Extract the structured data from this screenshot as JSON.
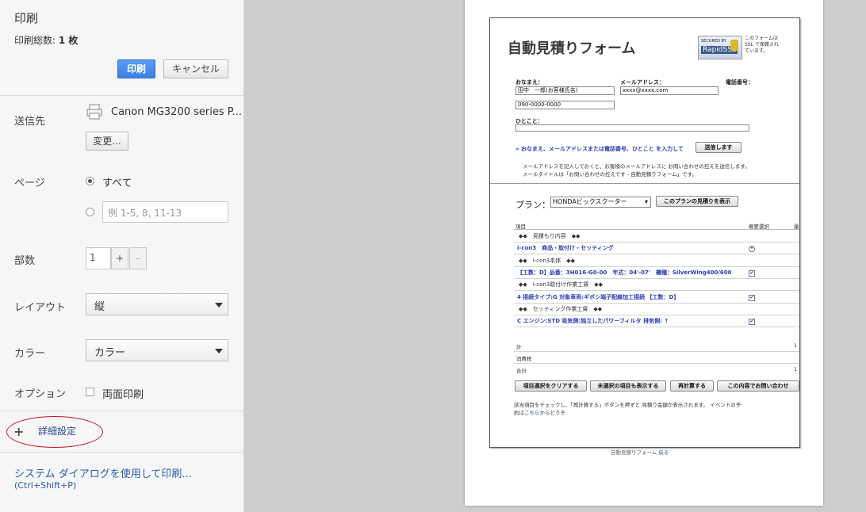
{
  "panel": {
    "title": "印刷",
    "total_label": "印刷総数:",
    "total_value": "1 枚",
    "print_button": "印刷",
    "cancel_button": "キャンセル",
    "destination": {
      "label": "送信先",
      "printer": "Canon MG3200 series P...",
      "change_button": "変更..."
    },
    "pages": {
      "label": "ページ",
      "option_all": "すべて",
      "custom_placeholder": "例 1-5, 8, 11-13"
    },
    "copies": {
      "label": "部数",
      "value": "1",
      "plus": "+",
      "minus": "–"
    },
    "layout": {
      "label": "レイアウト",
      "value": "縦"
    },
    "color": {
      "label": "カラー",
      "value": "カラー"
    },
    "options": {
      "label": "オプション",
      "duplex": "両面印刷"
    },
    "advanced": {
      "plus": "+",
      "label": "詳細設定"
    },
    "system_dialog": {
      "label": "システム ダイアログを使用して印刷...",
      "shortcut": "(Ctrl+Shift+P)"
    }
  },
  "preview": {
    "form_title": "自動見積りフォーム",
    "ssl_badge": {
      "line1": "SECURED BY",
      "line2": "RapidSSL"
    },
    "ssl_note": "このフォームは SSL で保護されています。",
    "name_label": "おなまえ：",
    "name_value": "田中　一郎(お客様氏名)",
    "email_label": "メールアドレス：",
    "email_value": "xxxx@xxxx.com",
    "phone_label": "電話番号：",
    "phone_value": "090-0000-0000",
    "comment_label": "ひとこと：",
    "send_instruction": "» おなまえ、メールアドレスまたは電話番号、ひとこと を入力して",
    "send_button": "送信します",
    "info_line1": "メールアドレスを記入しておくと、お客様のメールアドレスに お問い合わせの控えを送信します。",
    "info_line2": "メールタイトルは「お問い合わせの控えです - 自動見積りフォーム」です。",
    "plan_label": "プラン：",
    "plan_value": "HONDAビックスクーター",
    "plan_button": "このプランの見積りを表示",
    "table_header": {
      "item": "項目",
      "select": "概要選択",
      "col3": "量"
    },
    "rows": [
      {
        "text": "◆◆　見積もり内容　◆◆",
        "style": "normal",
        "mark": ""
      },
      {
        "text": "i-con3　商品・取付け・セッティング",
        "style": "blue",
        "mark": "radio"
      },
      {
        "text": "◆◆　i-con3本体　◆◆",
        "style": "normal",
        "mark": ""
      },
      {
        "text": "【工数：D】品番：3H016-G0-00　年式：04'-07'　機種：SilverWing400/600",
        "style": "blue",
        "mark": "check"
      },
      {
        "text": "◆◆　i-con3取付け作業工賃　◆◆",
        "style": "normal",
        "mark": ""
      },
      {
        "text": "4 接続タイプ:G 対象車両:ギボシ端子配線加工接続 【工数：D】",
        "style": "blue",
        "mark": "check"
      },
      {
        "text": "◆◆　セッティング作業工賃　◆◆",
        "style": "normal",
        "mark": ""
      },
      {
        "text": "C エンジン:STD 吸気側:独立したパワーフィルタ 排気側: ↑",
        "style": "blue",
        "mark": "check"
      }
    ],
    "totals": [
      {
        "label": "計",
        "value": "1"
      },
      {
        "label": "消費税",
        "value": ""
      },
      {
        "label": "合計",
        "value": "1"
      }
    ],
    "buttons": [
      "項目選択をクリアする",
      "未選択の項目も表示する",
      "再計算する",
      "この内容でお問い合わせ"
    ],
    "note_line1": "該当項目をチェックし、「再計算する」ボタンを押すと 見積り金額が表示されます。 イベントの予",
    "note_line2_prefix": "約は",
    "note_line2_link": "こちら",
    "note_line2_suffix": "からどうぞ",
    "footer": "自動見積りフォーム",
    "footer_link": "戻る"
  }
}
